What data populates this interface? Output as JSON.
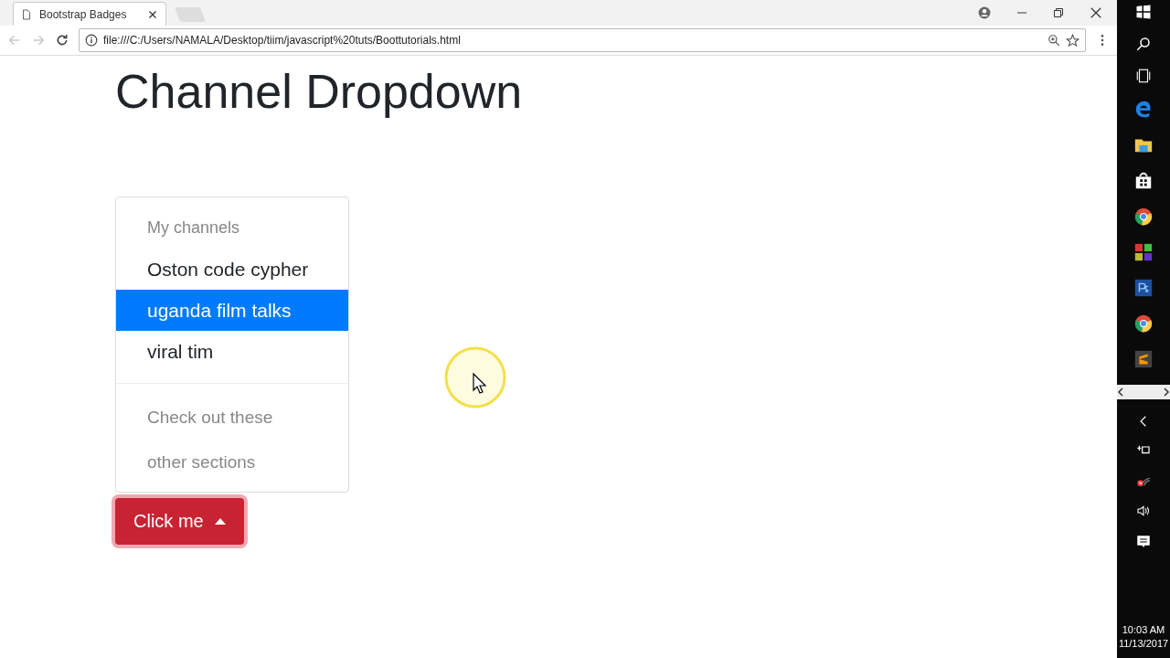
{
  "browser": {
    "tab_title": "Bootstrap Badges",
    "url": "file:///C:/Users/NAMALA/Desktop/tiim/javascript%20tuts/Boottutorials.html"
  },
  "page": {
    "heading": "Channel Dropdown"
  },
  "dropdown": {
    "entries": [
      {
        "kind": "header",
        "label": "My channels"
      },
      {
        "kind": "item",
        "label": "Oston code cypher",
        "selected": false,
        "disabled": false
      },
      {
        "kind": "item",
        "label": "uganda film talks",
        "selected": true,
        "disabled": false
      },
      {
        "kind": "item",
        "label": "viral tim",
        "selected": false,
        "disabled": false
      },
      {
        "kind": "divider"
      },
      {
        "kind": "item",
        "label": "Check out these",
        "selected": false,
        "disabled": true
      },
      {
        "kind": "item",
        "label": "other sections",
        "selected": false,
        "disabled": true
      }
    ],
    "button": {
      "label": "Click me",
      "expanded": true
    }
  },
  "taskbar": {
    "time": "10:03 AM",
    "date": "11/13/2017"
  }
}
